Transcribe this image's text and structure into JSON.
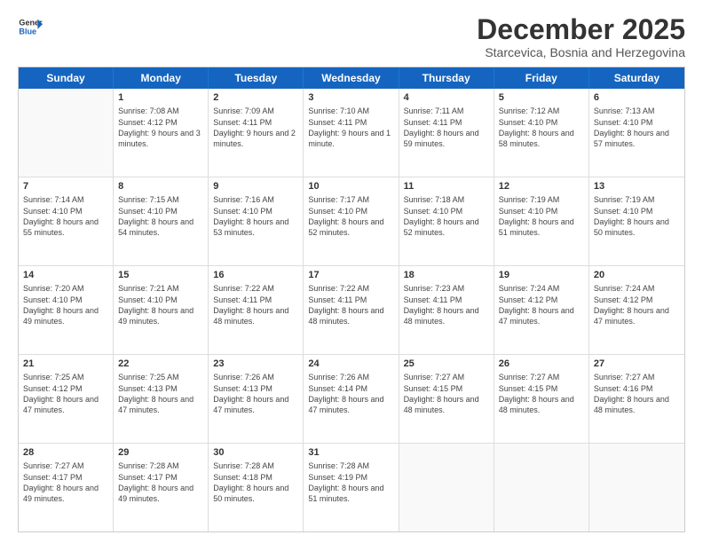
{
  "logo": {
    "line1": "General",
    "line2": "Blue"
  },
  "title": "December 2025",
  "subtitle": "Starcevica, Bosnia and Herzegovina",
  "header_days": [
    "Sunday",
    "Monday",
    "Tuesday",
    "Wednesday",
    "Thursday",
    "Friday",
    "Saturday"
  ],
  "weeks": [
    [
      {
        "day": "",
        "sunrise": "",
        "sunset": "",
        "daylight": ""
      },
      {
        "day": "1",
        "sunrise": "Sunrise: 7:08 AM",
        "sunset": "Sunset: 4:12 PM",
        "daylight": "Daylight: 9 hours and 3 minutes."
      },
      {
        "day": "2",
        "sunrise": "Sunrise: 7:09 AM",
        "sunset": "Sunset: 4:11 PM",
        "daylight": "Daylight: 9 hours and 2 minutes."
      },
      {
        "day": "3",
        "sunrise": "Sunrise: 7:10 AM",
        "sunset": "Sunset: 4:11 PM",
        "daylight": "Daylight: 9 hours and 1 minute."
      },
      {
        "day": "4",
        "sunrise": "Sunrise: 7:11 AM",
        "sunset": "Sunset: 4:11 PM",
        "daylight": "Daylight: 8 hours and 59 minutes."
      },
      {
        "day": "5",
        "sunrise": "Sunrise: 7:12 AM",
        "sunset": "Sunset: 4:10 PM",
        "daylight": "Daylight: 8 hours and 58 minutes."
      },
      {
        "day": "6",
        "sunrise": "Sunrise: 7:13 AM",
        "sunset": "Sunset: 4:10 PM",
        "daylight": "Daylight: 8 hours and 57 minutes."
      }
    ],
    [
      {
        "day": "7",
        "sunrise": "Sunrise: 7:14 AM",
        "sunset": "Sunset: 4:10 PM",
        "daylight": "Daylight: 8 hours and 55 minutes."
      },
      {
        "day": "8",
        "sunrise": "Sunrise: 7:15 AM",
        "sunset": "Sunset: 4:10 PM",
        "daylight": "Daylight: 8 hours and 54 minutes."
      },
      {
        "day": "9",
        "sunrise": "Sunrise: 7:16 AM",
        "sunset": "Sunset: 4:10 PM",
        "daylight": "Daylight: 8 hours and 53 minutes."
      },
      {
        "day": "10",
        "sunrise": "Sunrise: 7:17 AM",
        "sunset": "Sunset: 4:10 PM",
        "daylight": "Daylight: 8 hours and 52 minutes."
      },
      {
        "day": "11",
        "sunrise": "Sunrise: 7:18 AM",
        "sunset": "Sunset: 4:10 PM",
        "daylight": "Daylight: 8 hours and 52 minutes."
      },
      {
        "day": "12",
        "sunrise": "Sunrise: 7:19 AM",
        "sunset": "Sunset: 4:10 PM",
        "daylight": "Daylight: 8 hours and 51 minutes."
      },
      {
        "day": "13",
        "sunrise": "Sunrise: 7:19 AM",
        "sunset": "Sunset: 4:10 PM",
        "daylight": "Daylight: 8 hours and 50 minutes."
      }
    ],
    [
      {
        "day": "14",
        "sunrise": "Sunrise: 7:20 AM",
        "sunset": "Sunset: 4:10 PM",
        "daylight": "Daylight: 8 hours and 49 minutes."
      },
      {
        "day": "15",
        "sunrise": "Sunrise: 7:21 AM",
        "sunset": "Sunset: 4:10 PM",
        "daylight": "Daylight: 8 hours and 49 minutes."
      },
      {
        "day": "16",
        "sunrise": "Sunrise: 7:22 AM",
        "sunset": "Sunset: 4:11 PM",
        "daylight": "Daylight: 8 hours and 48 minutes."
      },
      {
        "day": "17",
        "sunrise": "Sunrise: 7:22 AM",
        "sunset": "Sunset: 4:11 PM",
        "daylight": "Daylight: 8 hours and 48 minutes."
      },
      {
        "day": "18",
        "sunrise": "Sunrise: 7:23 AM",
        "sunset": "Sunset: 4:11 PM",
        "daylight": "Daylight: 8 hours and 48 minutes."
      },
      {
        "day": "19",
        "sunrise": "Sunrise: 7:24 AM",
        "sunset": "Sunset: 4:12 PM",
        "daylight": "Daylight: 8 hours and 47 minutes."
      },
      {
        "day": "20",
        "sunrise": "Sunrise: 7:24 AM",
        "sunset": "Sunset: 4:12 PM",
        "daylight": "Daylight: 8 hours and 47 minutes."
      }
    ],
    [
      {
        "day": "21",
        "sunrise": "Sunrise: 7:25 AM",
        "sunset": "Sunset: 4:12 PM",
        "daylight": "Daylight: 8 hours and 47 minutes."
      },
      {
        "day": "22",
        "sunrise": "Sunrise: 7:25 AM",
        "sunset": "Sunset: 4:13 PM",
        "daylight": "Daylight: 8 hours and 47 minutes."
      },
      {
        "day": "23",
        "sunrise": "Sunrise: 7:26 AM",
        "sunset": "Sunset: 4:13 PM",
        "daylight": "Daylight: 8 hours and 47 minutes."
      },
      {
        "day": "24",
        "sunrise": "Sunrise: 7:26 AM",
        "sunset": "Sunset: 4:14 PM",
        "daylight": "Daylight: 8 hours and 47 minutes."
      },
      {
        "day": "25",
        "sunrise": "Sunrise: 7:27 AM",
        "sunset": "Sunset: 4:15 PM",
        "daylight": "Daylight: 8 hours and 48 minutes."
      },
      {
        "day": "26",
        "sunrise": "Sunrise: 7:27 AM",
        "sunset": "Sunset: 4:15 PM",
        "daylight": "Daylight: 8 hours and 48 minutes."
      },
      {
        "day": "27",
        "sunrise": "Sunrise: 7:27 AM",
        "sunset": "Sunset: 4:16 PM",
        "daylight": "Daylight: 8 hours and 48 minutes."
      }
    ],
    [
      {
        "day": "28",
        "sunrise": "Sunrise: 7:27 AM",
        "sunset": "Sunset: 4:17 PM",
        "daylight": "Daylight: 8 hours and 49 minutes."
      },
      {
        "day": "29",
        "sunrise": "Sunrise: 7:28 AM",
        "sunset": "Sunset: 4:17 PM",
        "daylight": "Daylight: 8 hours and 49 minutes."
      },
      {
        "day": "30",
        "sunrise": "Sunrise: 7:28 AM",
        "sunset": "Sunset: 4:18 PM",
        "daylight": "Daylight: 8 hours and 50 minutes."
      },
      {
        "day": "31",
        "sunrise": "Sunrise: 7:28 AM",
        "sunset": "Sunset: 4:19 PM",
        "daylight": "Daylight: 8 hours and 51 minutes."
      },
      {
        "day": "",
        "sunrise": "",
        "sunset": "",
        "daylight": ""
      },
      {
        "day": "",
        "sunrise": "",
        "sunset": "",
        "daylight": ""
      },
      {
        "day": "",
        "sunrise": "",
        "sunset": "",
        "daylight": ""
      }
    ]
  ]
}
